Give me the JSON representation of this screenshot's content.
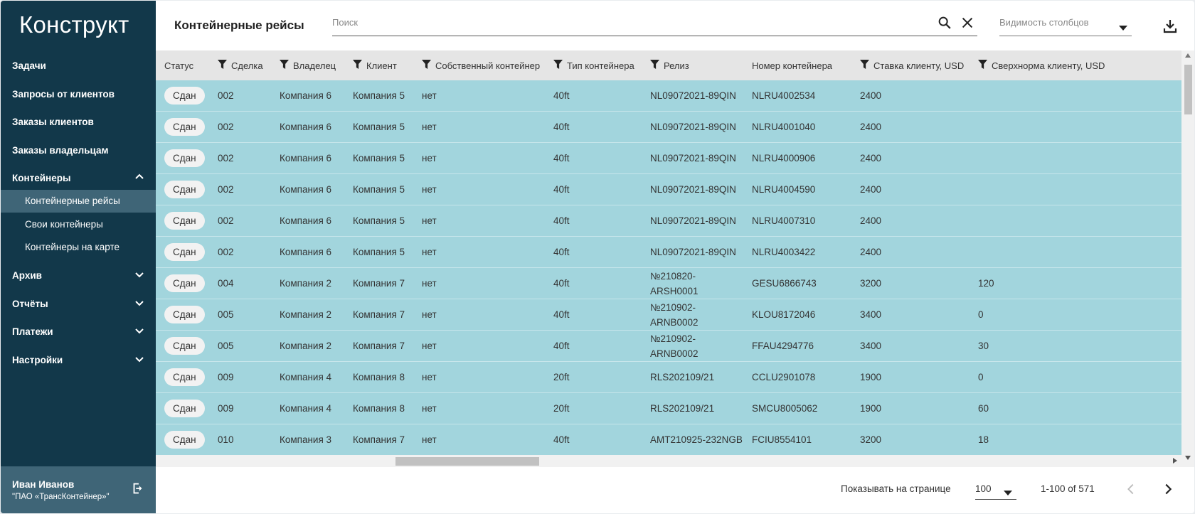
{
  "app": {
    "logo": "Конструкт"
  },
  "nav": [
    {
      "label": "Задачи",
      "chevron": ""
    },
    {
      "label": "Запросы от клиентов",
      "chevron": ""
    },
    {
      "label": "Заказы клиентов",
      "chevron": ""
    },
    {
      "label": "Заказы владельцам",
      "chevron": ""
    },
    {
      "label": "Контейнеры",
      "chevron": "up"
    }
  ],
  "subnav": [
    {
      "label": "Контейнерные рейсы",
      "active": true
    },
    {
      "label": "Свои контейнеры",
      "active": false
    },
    {
      "label": "Контейнеры на карте",
      "active": false
    }
  ],
  "nav2": [
    {
      "label": "Архив",
      "chevron": "down"
    },
    {
      "label": "Отчёты",
      "chevron": "down"
    },
    {
      "label": "Платежи",
      "chevron": "down"
    },
    {
      "label": "Настройки",
      "chevron": "down"
    }
  ],
  "user": {
    "name": "Иван Иванов",
    "org": "\"ПАО «ТрансКонтейнер»\""
  },
  "toolbar": {
    "title": "Контейнерные рейсы",
    "search_placeholder": "Поиск",
    "column_visibility": "Видимость столбцов"
  },
  "table": {
    "columns": [
      {
        "label": "Статус",
        "filter": false
      },
      {
        "label": "Сделка",
        "filter": true
      },
      {
        "label": "Владелец",
        "filter": true
      },
      {
        "label": "Клиент",
        "filter": true
      },
      {
        "label": "Собственный контейнер",
        "filter": true
      },
      {
        "label": "Тип контейнера",
        "filter": true
      },
      {
        "label": "Релиз",
        "filter": true
      },
      {
        "label": "Номер контейнера",
        "filter": false
      },
      {
        "label": "Ставка клиенту, USD",
        "filter": true
      },
      {
        "label": "Сверхнорма клиенту, USD",
        "filter": true
      }
    ],
    "rows": [
      [
        "Сдан",
        "002",
        "Компания 6",
        "Компания 5",
        "нет",
        "40ft",
        "NL09072021-89QIN",
        "NLRU4002534",
        "2400",
        ""
      ],
      [
        "Сдан",
        "002",
        "Компания 6",
        "Компания 5",
        "нет",
        "40ft",
        "NL09072021-89QIN",
        "NLRU4001040",
        "2400",
        ""
      ],
      [
        "Сдан",
        "002",
        "Компания 6",
        "Компания 5",
        "нет",
        "40ft",
        "NL09072021-89QIN",
        "NLRU4000906",
        "2400",
        ""
      ],
      [
        "Сдан",
        "002",
        "Компания 6",
        "Компания 5",
        "нет",
        "40ft",
        "NL09072021-89QIN",
        "NLRU4004590",
        "2400",
        ""
      ],
      [
        "Сдан",
        "002",
        "Компания 6",
        "Компания 5",
        "нет",
        "40ft",
        "NL09072021-89QIN",
        "NLRU4007310",
        "2400",
        ""
      ],
      [
        "Сдан",
        "002",
        "Компания 6",
        "Компания 5",
        "нет",
        "40ft",
        "NL09072021-89QIN",
        "NLRU4003422",
        "2400",
        ""
      ],
      [
        "Сдан",
        "004",
        "Компания 2",
        "Компания 7",
        "нет",
        "40ft",
        "№210820-ARSH0001",
        "GESU6866743",
        "3200",
        "120"
      ],
      [
        "Сдан",
        "005",
        "Компания 2",
        "Компания 7",
        "нет",
        "40ft",
        "№210902-ARNB0002",
        "KLOU8172046",
        "3400",
        "0"
      ],
      [
        "Сдан",
        "005",
        "Компания 2",
        "Компания 7",
        "нет",
        "40ft",
        "№210902-ARNB0002",
        "FFAU4294776",
        "3400",
        "30"
      ],
      [
        "Сдан",
        "009",
        "Компания 4",
        "Компания 8",
        "нет",
        "20ft",
        "RLS202109/21",
        "CCLU2901078",
        "1900",
        "0"
      ],
      [
        "Сдан",
        "009",
        "Компания 4",
        "Компания 8",
        "нет",
        "20ft",
        "RLS202109/21",
        "SMCU8005062",
        "1900",
        "60"
      ],
      [
        "Сдан",
        "010",
        "Компания 3",
        "Компания 7",
        "нет",
        "40ft",
        "AMT210925-232NGB",
        "FCIU8554101",
        "3200",
        "18"
      ]
    ],
    "row_color": "#a2d5dd"
  },
  "footer": {
    "rows_per_page_label": "Показывать на странице",
    "rows_per_page": "100",
    "range": "1-100 of 571"
  },
  "colors": {
    "sidebar": "#12384a",
    "sidebar_active": "#3f6577",
    "row": "#a2d5dd"
  }
}
